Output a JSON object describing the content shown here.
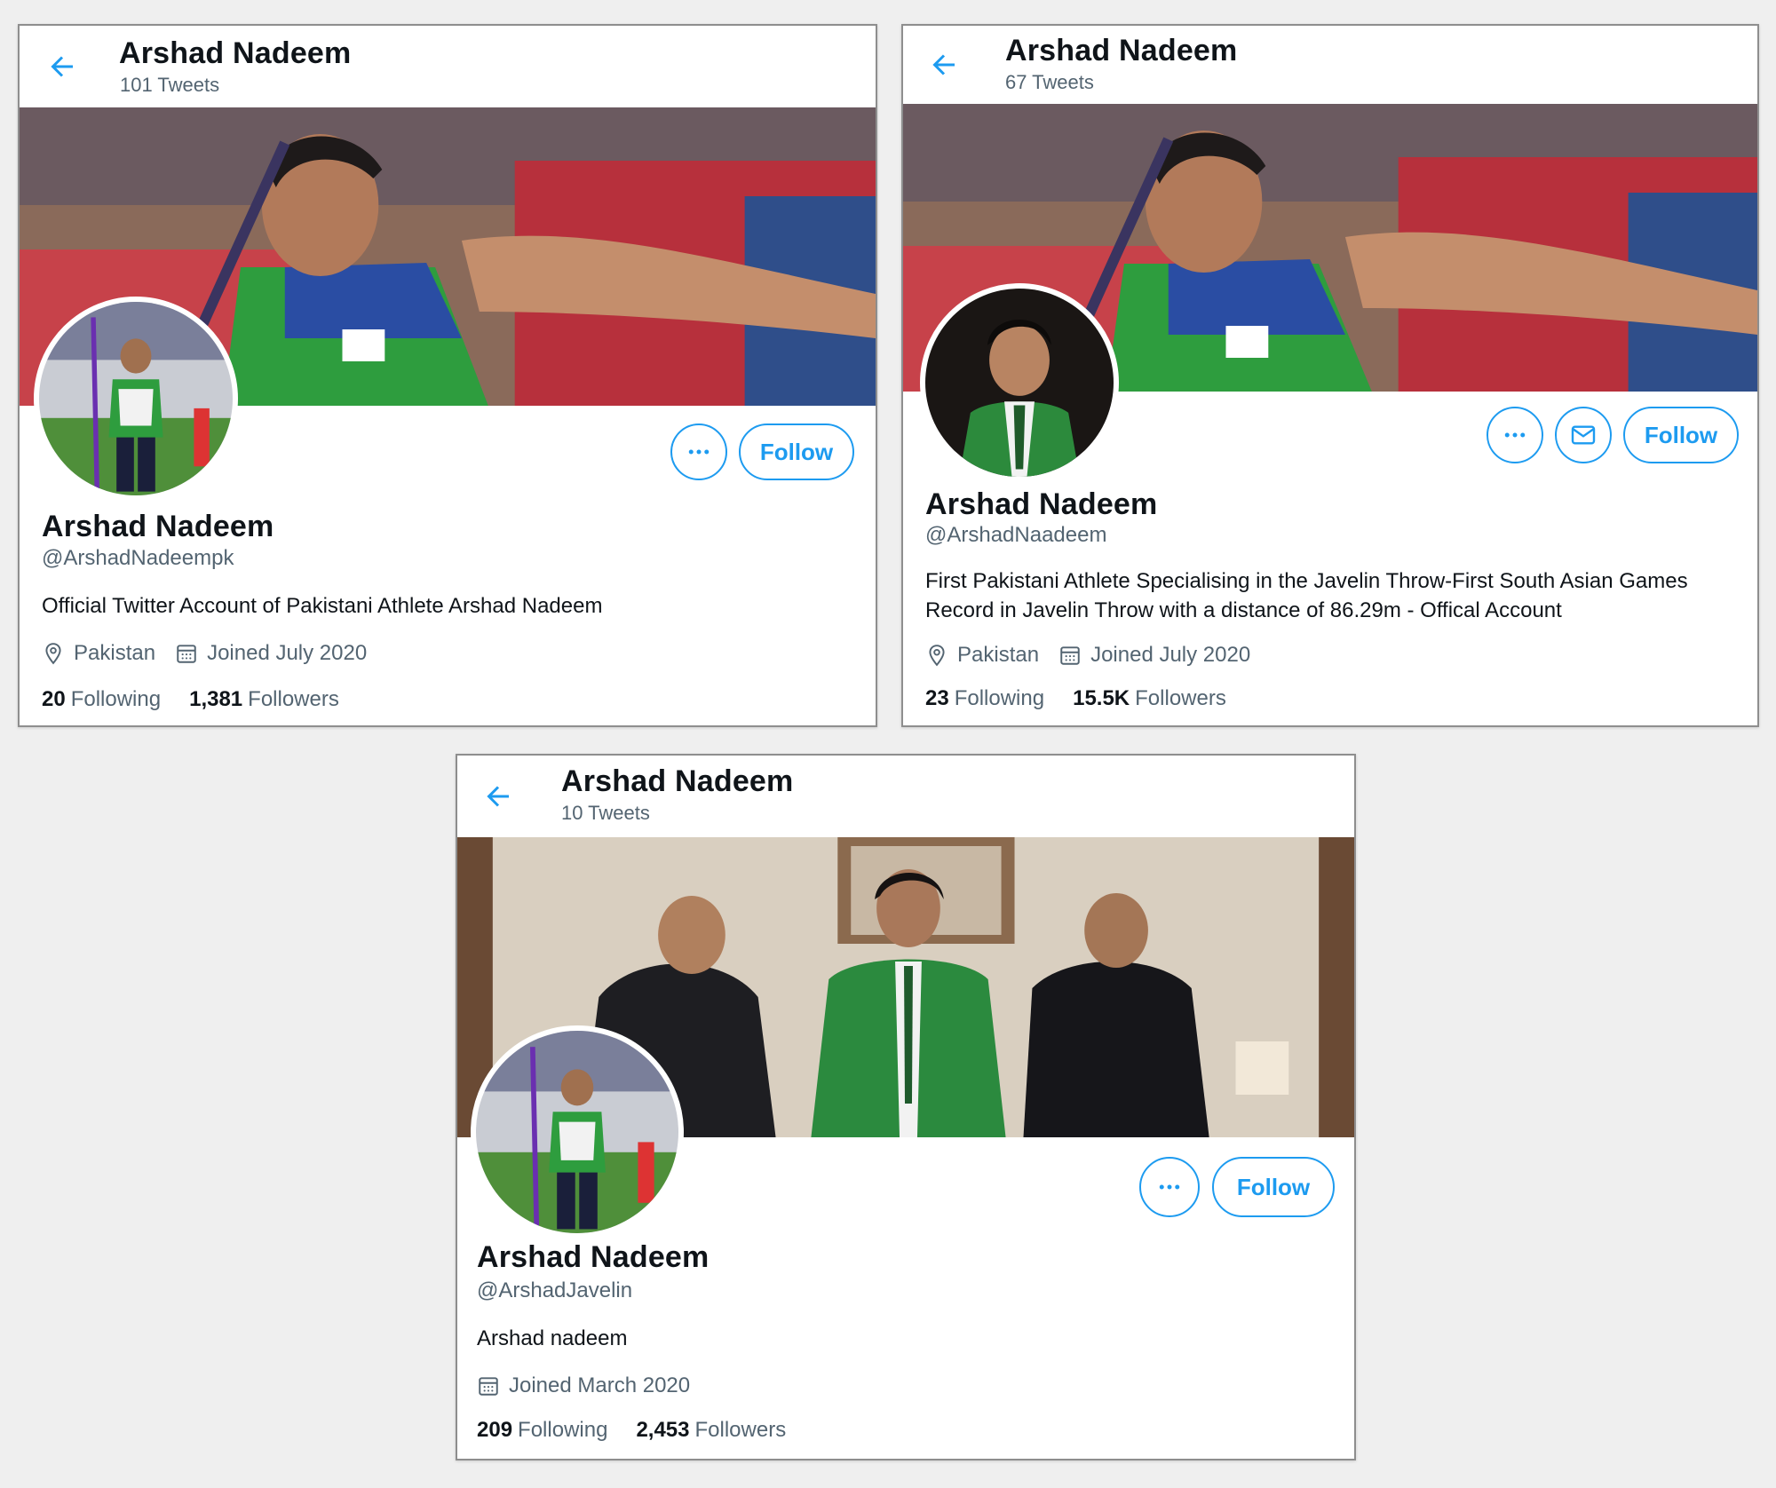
{
  "profiles": [
    {
      "topbar": {
        "title": "Arshad Nadeem",
        "tweets": "101 Tweets"
      },
      "name": "Arshad Nadeem",
      "handle": "@ArshadNadeempk",
      "bio": "Official Twitter Account of Pakistani Athlete Arshad Nadeem",
      "location": "Pakistan",
      "joined": "Joined July 2020",
      "following_count": "20",
      "following_label": "Following",
      "followers_count": "1,381",
      "followers_label": "Followers",
      "follow_label": "Follow"
    },
    {
      "topbar": {
        "title": "Arshad Nadeem",
        "tweets": "67 Tweets"
      },
      "name": "Arshad Nadeem",
      "handle": "@ArshadNaadeem",
      "bio": "First Pakistani Athlete Specialising in the Javelin Throw-First South Asian Games Record in Javelin Throw with a distance of 86.29m - Offical Account",
      "location": "Pakistan",
      "joined": "Joined July 2020",
      "following_count": "23",
      "following_label": "Following",
      "followers_count": "15.5K",
      "followers_label": "Followers",
      "follow_label": "Follow"
    },
    {
      "topbar": {
        "title": "Arshad Nadeem",
        "tweets": "10 Tweets"
      },
      "name": "Arshad Nadeem",
      "handle": "@ArshadJavelin",
      "bio": "Arshad nadeem",
      "joined": "Joined March 2020",
      "following_count": "209",
      "following_label": "Following",
      "followers_count": "2,453",
      "followers_label": "Followers",
      "follow_label": "Follow"
    }
  ],
  "icons": {
    "back": "arrow-left-icon",
    "more": "more-dots-icon",
    "message": "envelope-icon",
    "location": "location-pin-icon",
    "calendar": "calendar-icon"
  },
  "colors": {
    "accent": "#1d9bf0",
    "secondary_text": "#536471",
    "primary_text": "#0f1419",
    "page_bg": "#efefef"
  }
}
